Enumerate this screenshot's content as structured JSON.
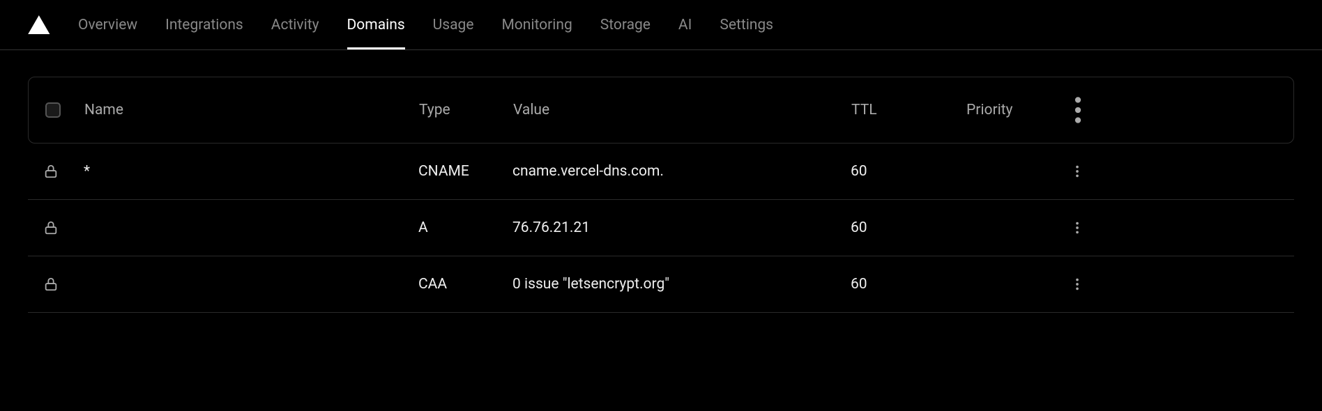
{
  "nav": {
    "items": [
      {
        "label": "Overview",
        "active": false
      },
      {
        "label": "Integrations",
        "active": false
      },
      {
        "label": "Activity",
        "active": false
      },
      {
        "label": "Domains",
        "active": true
      },
      {
        "label": "Usage",
        "active": false
      },
      {
        "label": "Monitoring",
        "active": false
      },
      {
        "label": "Storage",
        "active": false
      },
      {
        "label": "AI",
        "active": false
      },
      {
        "label": "Settings",
        "active": false
      }
    ]
  },
  "table": {
    "headers": {
      "name": "Name",
      "type": "Type",
      "value": "Value",
      "ttl": "TTL",
      "priority": "Priority"
    },
    "rows": [
      {
        "locked": true,
        "name": "*",
        "type": "CNAME",
        "value": "cname.vercel-dns.com.",
        "ttl": "60",
        "priority": ""
      },
      {
        "locked": true,
        "name": "",
        "type": "A",
        "value": "76.76.21.21",
        "ttl": "60",
        "priority": ""
      },
      {
        "locked": true,
        "name": "",
        "type": "CAA",
        "value": "0 issue \"letsencrypt.org\"",
        "ttl": "60",
        "priority": ""
      }
    ]
  }
}
